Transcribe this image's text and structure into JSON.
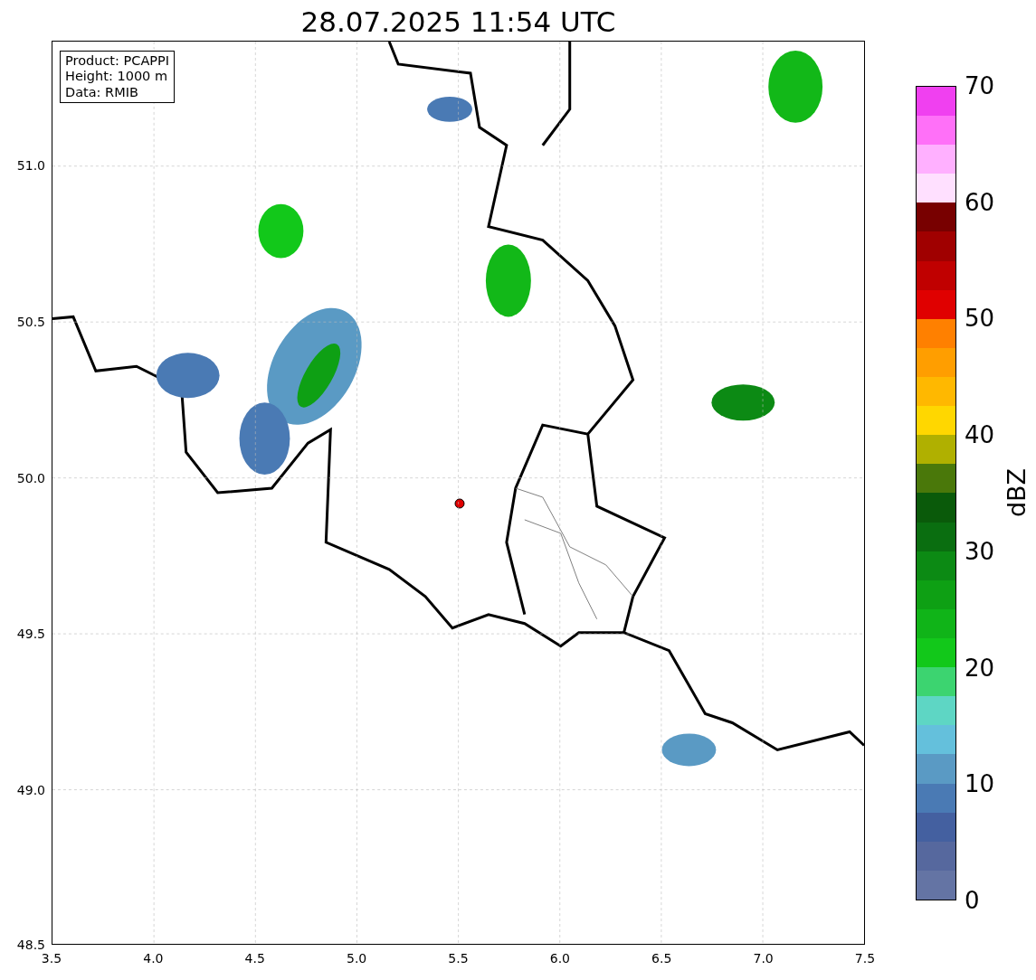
{
  "title": "28.07.2025 11:54 UTC",
  "info_box": [
    "Product: PCAPPI",
    "Height: 1000 m",
    "Data: RMIB"
  ],
  "x_axis": {
    "ticks": [
      "3.5",
      "4.0",
      "4.5",
      "5.0",
      "5.5",
      "6.0",
      "6.5",
      "7.0",
      "7.5"
    ]
  },
  "y_axis": {
    "ticks": [
      "51.0",
      "50.5",
      "50.0",
      "49.5",
      "49.0",
      "48.5"
    ]
  },
  "colorbar": {
    "label": "dBZ",
    "ticks": [
      "70",
      "60",
      "50",
      "40",
      "30",
      "20",
      "10",
      "0"
    ],
    "bands": [
      {
        "color": "#6474a4"
      },
      {
        "color": "#56689e"
      },
      {
        "color": "#4460a0"
      },
      {
        "color": "#4a7ab4"
      },
      {
        "color": "#5a9ac4"
      },
      {
        "color": "#64c0dc"
      },
      {
        "color": "#5ed6c4"
      },
      {
        "color": "#3cd470"
      },
      {
        "color": "#12c81a"
      },
      {
        "color": "#10b418"
      },
      {
        "color": "#0ea014"
      },
      {
        "color": "#0c8a14"
      },
      {
        "color": "#0a6e10"
      },
      {
        "color": "#0a5a0a"
      },
      {
        "color": "#4a780a"
      },
      {
        "color": "#b0b000"
      },
      {
        "color": "#ffd700"
      },
      {
        "color": "#ffb800"
      },
      {
        "color": "#ff9e00"
      },
      {
        "color": "#ff8000"
      },
      {
        "color": "#e00000"
      },
      {
        "color": "#c00000"
      },
      {
        "color": "#a00000"
      },
      {
        "color": "#780000"
      },
      {
        "color": "#ffe0ff"
      },
      {
        "color": "#ffb0ff"
      },
      {
        "color": "#ff70f8"
      },
      {
        "color": "#f040f0"
      }
    ]
  }
}
